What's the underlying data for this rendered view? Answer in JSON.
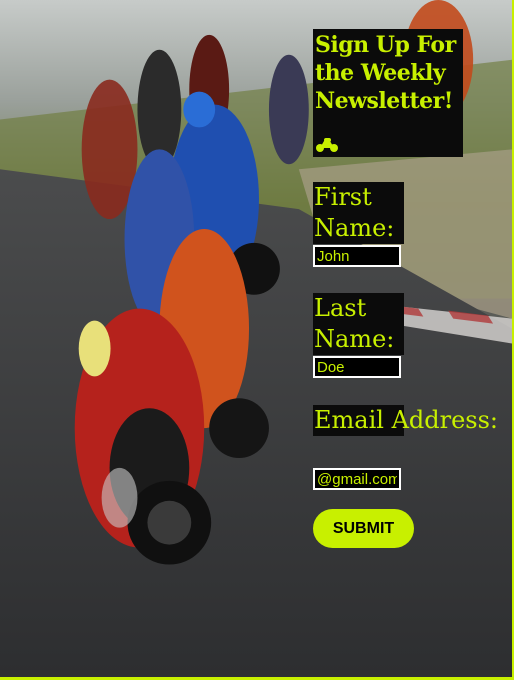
{
  "form": {
    "title": "Sign Up For the Weekly Newsletter!",
    "icon": "motorcycle-icon",
    "first_name_label": "First Name:",
    "first_name_value": "John",
    "last_name_label": "Last Name:",
    "last_name_value": "Doe",
    "email_label": "Email Address:",
    "email_value": "@gmail.com",
    "submit_label": "SUBMIT"
  },
  "colors": {
    "accent": "#c8f000",
    "panel": "#0b0b0b",
    "field_border": "#ffffff"
  }
}
